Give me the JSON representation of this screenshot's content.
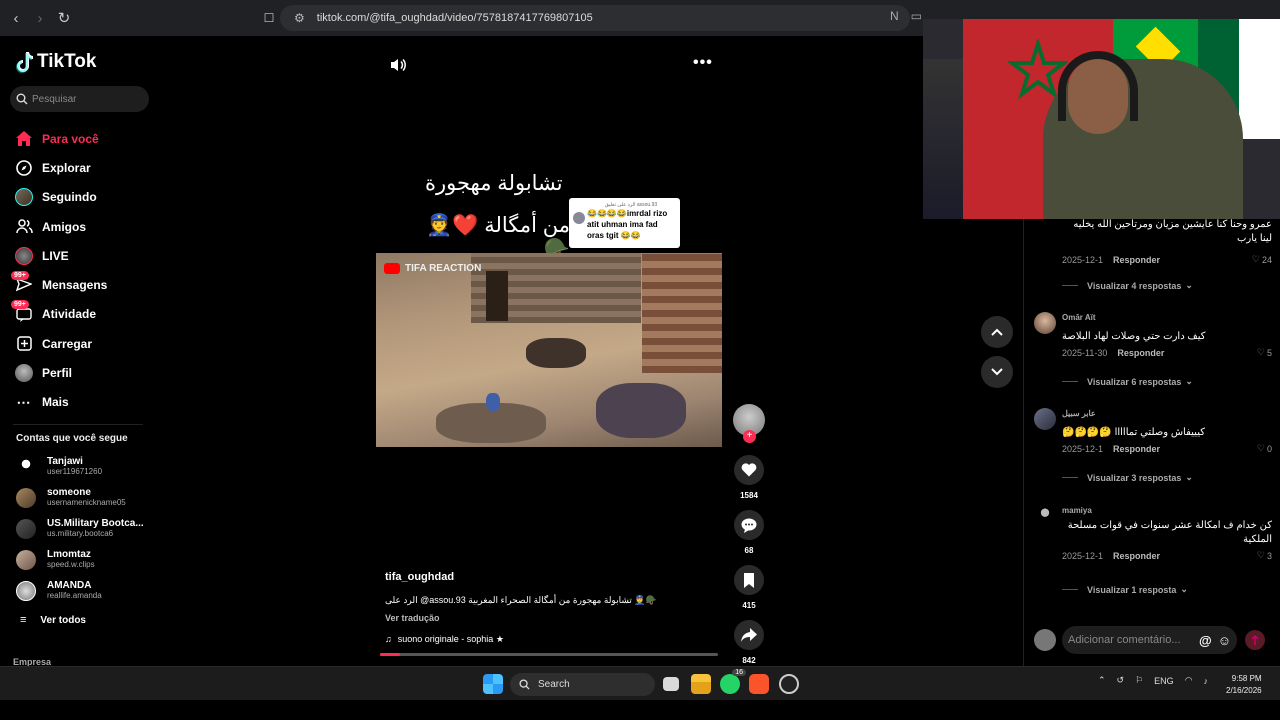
{
  "browser": {
    "url": "tiktok.com/@tifa_oughdad/video/7578187417769807105"
  },
  "sidebar": {
    "logo": "TikTok",
    "search_placeholder": "Pesquisar",
    "menu": [
      {
        "label": "Para você",
        "icon": "home-icon",
        "active": true
      },
      {
        "label": "Explorar",
        "icon": "compass-icon"
      },
      {
        "label": "Seguindo",
        "icon": "following-avatar-icon"
      },
      {
        "label": "Amigos",
        "icon": "friends-icon"
      },
      {
        "label": "LIVE",
        "icon": "live-icon"
      },
      {
        "label": "Mensagens",
        "icon": "messages-icon",
        "badge": "99+"
      },
      {
        "label": "Atividade",
        "icon": "activity-icon",
        "badge": "99+"
      },
      {
        "label": "Carregar",
        "icon": "upload-icon"
      },
      {
        "label": "Perfil",
        "icon": "profile-avatar-icon"
      },
      {
        "label": "Mais",
        "icon": "more-icon"
      }
    ],
    "following_title": "Contas que você segue",
    "accounts": [
      {
        "name": "Tanjawi",
        "handle": "user119671260"
      },
      {
        "name": "someone",
        "handle": "usernamenickname05"
      },
      {
        "name": "US.Military Bootca...",
        "handle": "us.military.bootca6"
      },
      {
        "name": "Lmomtaz",
        "handle": "speed.w.clips"
      },
      {
        "name": "AMANDA",
        "handle": "reallife.amanda"
      }
    ],
    "see_all": "Ver todos",
    "footer": "Empresa"
  },
  "video": {
    "caption_line1": "تشابولة مهجورة",
    "caption_line2": "من أمگالة ❤️👮🪖",
    "reply_bubble": {
      "header": "الرد على تعليق assou.93",
      "text": "😂😂😂😂imrdal rizo atit uhman ima fad oras tgit 😂😂"
    },
    "overlay_logo": "TIFA REACTION",
    "author": "tifa_oughdad",
    "description": "الرد على @assou.93 تشابولة مهجورة من أمگالة الصحراء المغربية 👮🪖",
    "translate": "Ver tradução",
    "music": "suono originale - sophia ★",
    "progress": 0.06,
    "actions": {
      "likes": "1584",
      "comments": "68",
      "saves": "415",
      "shares": "842"
    }
  },
  "comments": {
    "items": [
      {
        "user": "",
        "text": "عمرو وحنا كنا عايشين مزيان ومرتاحين الله يخليه لينا يارب",
        "date": "2025-12-1",
        "reply": "Responder",
        "likes": "24",
        "replies": "Visualizar 4 respostas"
      },
      {
        "user": "Omār Aït",
        "text": "كيف دارت حتي وصلات لهاد البلاصة",
        "date": "2025-11-30",
        "reply": "Responder",
        "likes": "5",
        "replies": "Visualizar 6 respostas"
      },
      {
        "user": "عابر سبيل",
        "text": "كيييفاش وصلتي تمااااا 🤔🤔🤔🤔",
        "date": "2025-12-1",
        "reply": "Responder",
        "likes": "0",
        "replies": "Visualizar 3 respostas"
      },
      {
        "user": "mamiya",
        "text": "كن خدام ف امكالة عشر سنوات في قوات مسلحة الملكية",
        "date": "2025-12-1",
        "reply": "Responder",
        "likes": "3",
        "replies": "Visualizar 1 resposta"
      }
    ],
    "add_placeholder": "Adicionar comentário..."
  },
  "taskbar": {
    "search": "Search",
    "whatsapp_badge": "16",
    "lang": "ENG",
    "time": "9:58 PM",
    "date": "2/16/2026"
  }
}
